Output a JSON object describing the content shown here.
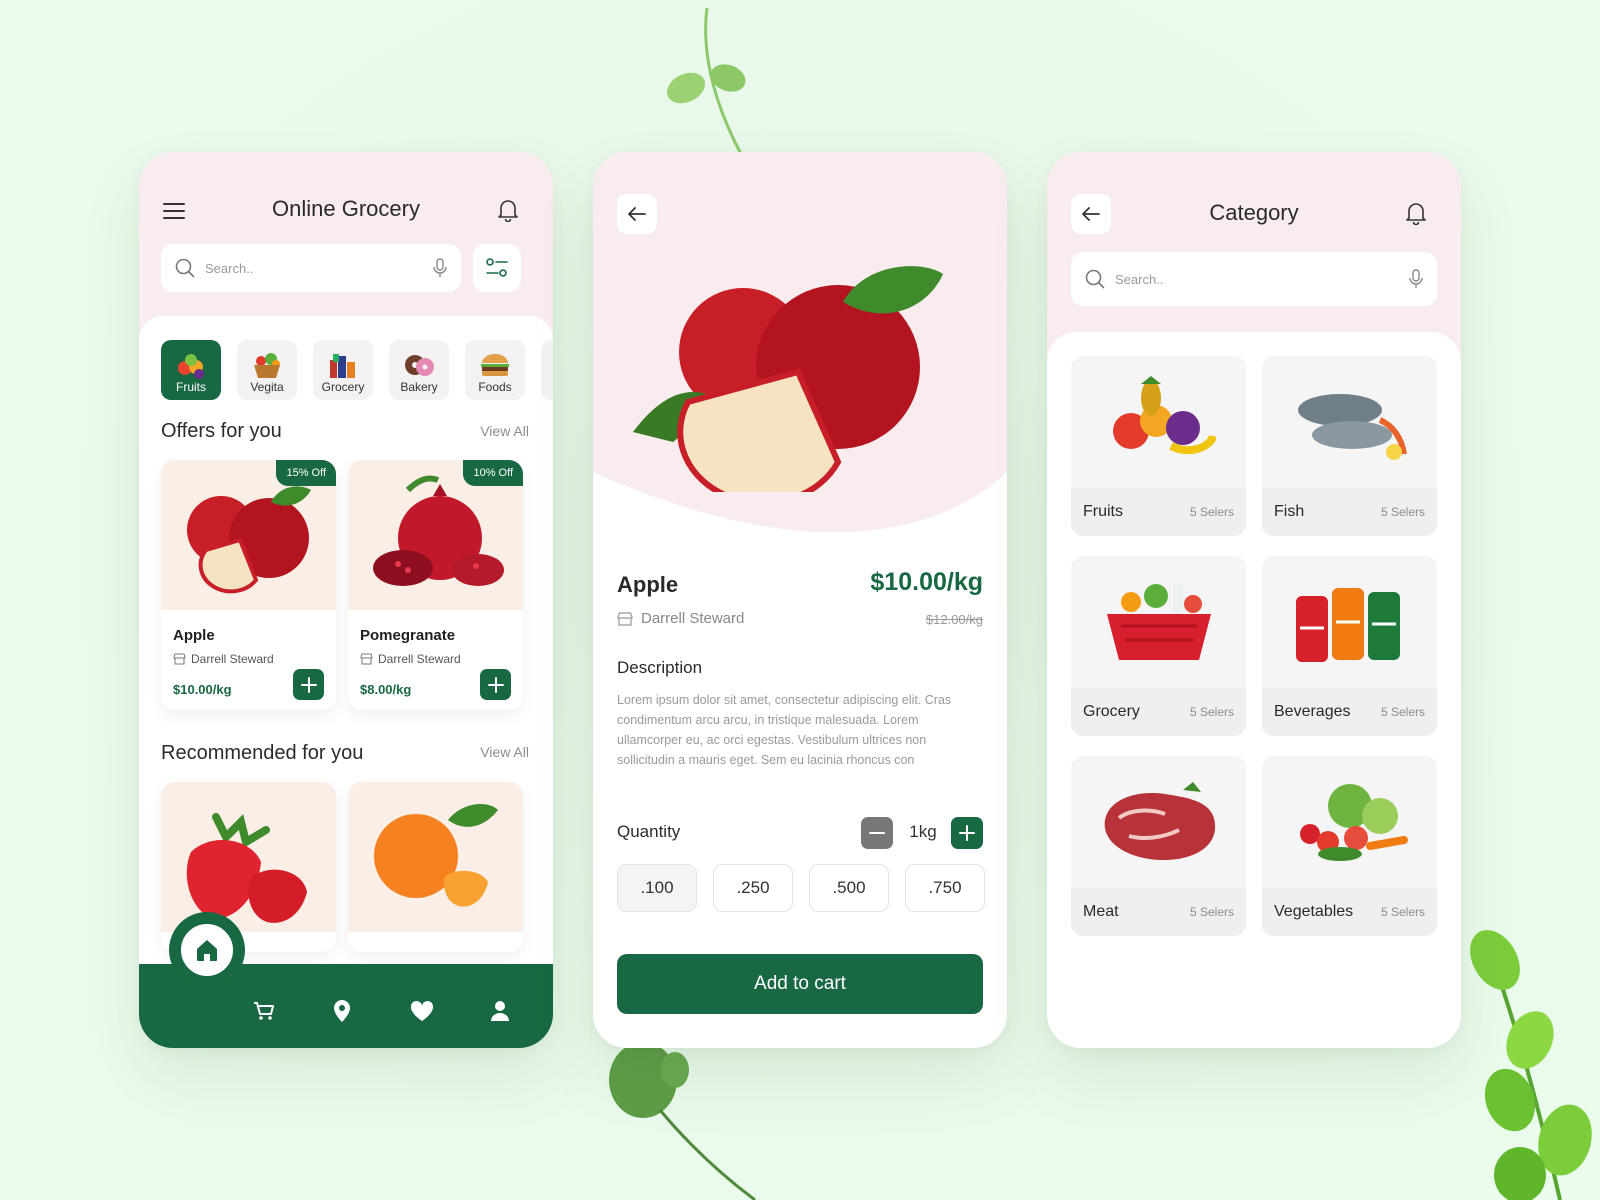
{
  "home": {
    "title": "Online Grocery",
    "search_placeholder": "Search..",
    "categories": [
      {
        "label": "Fruits",
        "active": true
      },
      {
        "label": "Vegita",
        "active": false
      },
      {
        "label": "Grocery",
        "active": false
      },
      {
        "label": "Bakery",
        "active": false
      },
      {
        "label": "Foods",
        "active": false
      }
    ],
    "offers_title": "Offers for you",
    "offers_view_all": "View All",
    "offers": [
      {
        "badge": "15% Off",
        "name": "Apple",
        "seller": "Darrell Steward",
        "price": "$10.00/kg"
      },
      {
        "badge": "10% Off",
        "name": "Pomegranate",
        "seller": "Darrell Steward",
        "price": "$8.00/kg"
      }
    ],
    "recommended_title": "Recommended for you",
    "recommended_view_all": "View All",
    "nav": [
      "home-icon",
      "cart-icon",
      "location-icon",
      "heart-icon",
      "profile-icon"
    ]
  },
  "detail": {
    "name": "Apple",
    "price": "$10.00/kg",
    "old_price": "$12.00/kg",
    "seller": "Darrell Steward",
    "description_title": "Description",
    "description": "Lorem ipsum dolor sit amet, consectetur adipiscing elit. Cras condimentum arcu arcu, in tristique malesuada. Lorem ullamcorper eu, ac orci egestas. Vestibulum ultrices non sollicitudin a mauris eget. Sem eu lacinia rhoncus con",
    "quantity_label": "Quantity",
    "quantity_value": "1kg",
    "quantity_options": [
      ".100",
      ".250",
      ".500",
      ".750"
    ],
    "add_to_cart": "Add to cart"
  },
  "category": {
    "title": "Category",
    "search_placeholder": "Search..",
    "items": [
      {
        "name": "Fruits",
        "sellers": "5 Selers"
      },
      {
        "name": "Fish",
        "sellers": "5 Selers"
      },
      {
        "name": "Grocery",
        "sellers": "5 Selers"
      },
      {
        "name": "Beverages",
        "sellers": "5 Selers"
      },
      {
        "name": "Meat",
        "sellers": "5 Selers"
      },
      {
        "name": "Vegetables",
        "sellers": "5 Selers"
      }
    ]
  },
  "colors": {
    "brand_green": "#186843",
    "pink_bg": "#f9ecef",
    "page_bg": "#e9f8ea"
  }
}
